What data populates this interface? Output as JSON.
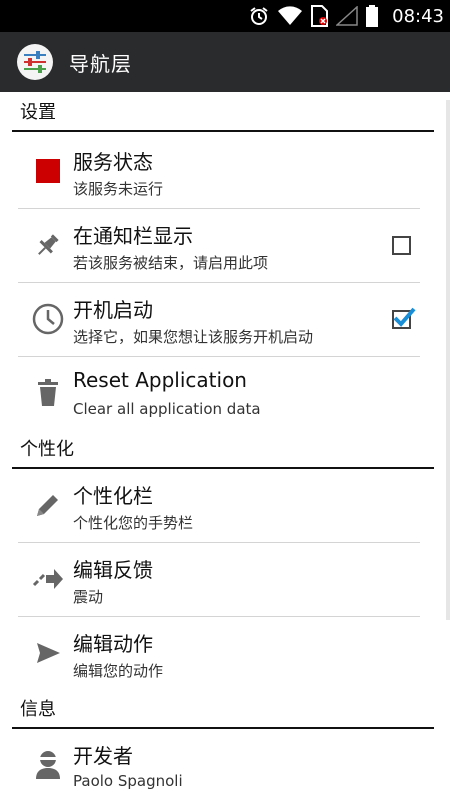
{
  "status_bar": {
    "time": "08:43",
    "icons": [
      "alarm-icon",
      "wifi-icon",
      "no-sim-icon",
      "signal-icon",
      "battery-icon"
    ]
  },
  "action_bar": {
    "title": "导航层",
    "logo_icon": "sliders-icon"
  },
  "sections": {
    "settings": {
      "header": "设置",
      "items": [
        {
          "title": "服务状态",
          "summary": "该服务未运行",
          "icon": "stop-square-icon",
          "status_color": "#cc0000"
        },
        {
          "title": "在通知栏显示",
          "summary": "若该服务被结束，请启用此项",
          "icon": "pin-icon",
          "checked": false
        },
        {
          "title": "开机启动",
          "summary": "选择它，如果您想让该服务开机启动",
          "icon": "clock-icon",
          "checked": true
        },
        {
          "title": "Reset Application",
          "summary": "Clear all application data",
          "icon": "trash-icon"
        }
      ]
    },
    "personalize": {
      "header": "个性化",
      "items": [
        {
          "title": "个性化栏",
          "summary": "个性化您的手势栏",
          "icon": "pencil-icon"
        },
        {
          "title": "编辑反馈",
          "summary": "震动",
          "icon": "dashed-arrow-icon"
        },
        {
          "title": "编辑动作",
          "summary": "编辑您的动作",
          "icon": "send-icon"
        }
      ]
    },
    "info": {
      "header": "信息",
      "items": [
        {
          "title": "开发者",
          "summary": "Paolo Spagnoli",
          "icon": "person-icon"
        }
      ]
    }
  },
  "colors": {
    "action_bar": "#2a2b2d",
    "check_accent": "#1a8fd8",
    "stop_red": "#cc0000"
  }
}
